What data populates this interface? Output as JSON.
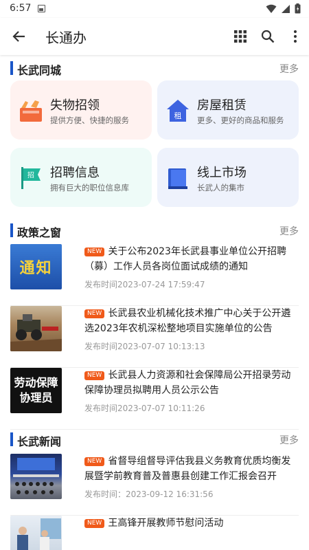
{
  "status": {
    "time": "6:57"
  },
  "app_bar": {
    "title": "长通办"
  },
  "sections": {
    "community": {
      "title": "长武同城",
      "more": "更多",
      "cards": [
        {
          "title": "失物招领",
          "subtitle": "提供方便、快捷的服务"
        },
        {
          "title": "房屋租赁",
          "subtitle": "更多、更好的商品和服务"
        },
        {
          "title": "招聘信息",
          "subtitle": "拥有巨大的职位信息库"
        },
        {
          "title": "线上市场",
          "subtitle": "长武人的集市"
        }
      ]
    },
    "policy": {
      "title": "政策之窗",
      "more": "更多",
      "articles": [
        {
          "badge": "NEW",
          "title": "关于公布2023年长武县事业单位公开招聘（募）工作人员各岗位面试成绩的通知",
          "date": "发布时间2023-07-24 17:59:47",
          "thumb_text": "通知"
        },
        {
          "badge": "NEW",
          "title": "长武县农业机械化技术推广中心关于公开遴选2023年农机深松整地项目实施单位的公告",
          "date": "发布时间2023-07-07 10:13:13"
        },
        {
          "badge": "NEW",
          "title": "长武县人力资源和社会保障局公开招录劳动保障协理员拟聘用人员公示公告",
          "date": "发布时间2023-07-07 10:11:26",
          "thumb_text": "劳动保障协理员"
        }
      ]
    },
    "news": {
      "title": "长武新闻",
      "more": "更多",
      "articles": [
        {
          "badge": "NEW",
          "title": "省督导组督导评估我县义务教育优质均衡发展暨学前教育普及普惠县创建工作汇报会召开",
          "date": "发布时间：2023-09-12 16:31:56"
        },
        {
          "badge": "NEW",
          "title": "王高锋开展教师节慰问活动",
          "date": ""
        }
      ]
    }
  },
  "colors": {
    "accent": "#1a56c8",
    "badge": "#f05a1a"
  },
  "icons": [
    "back-arrow-icon",
    "grid-icon",
    "search-icon",
    "more-vert-icon",
    "wifi-icon",
    "signal-icon",
    "battery-icon",
    "image-icon"
  ]
}
